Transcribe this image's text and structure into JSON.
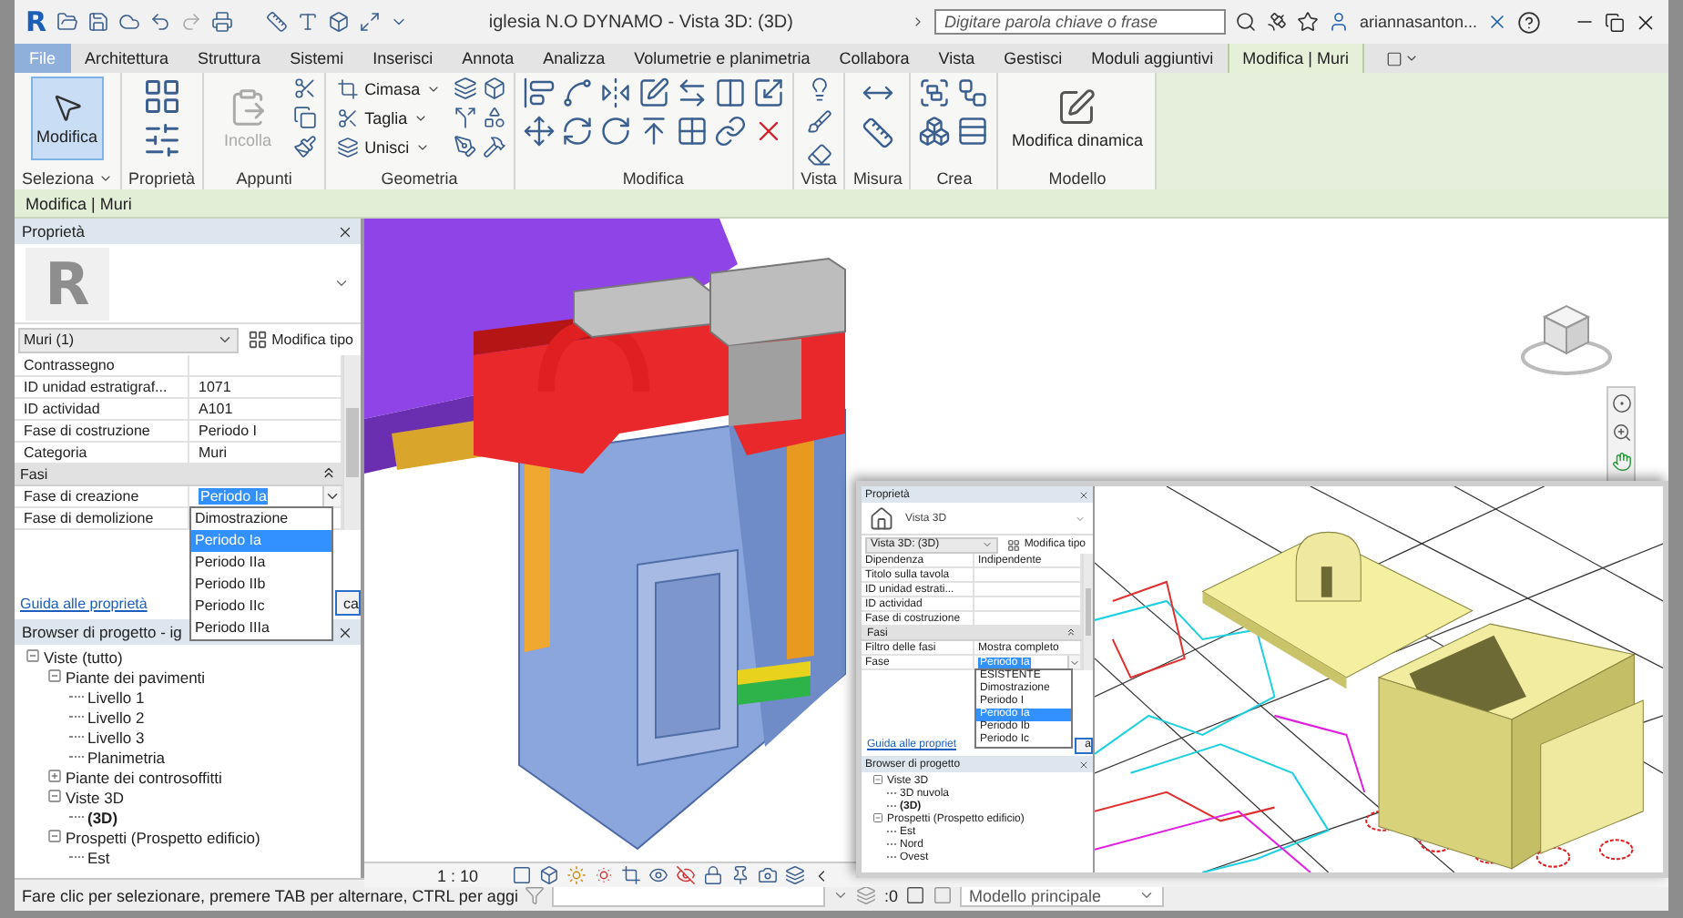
{
  "app_logo": "R",
  "title_bar": {
    "title": "iglesia N.O DYNAMO - Vista 3D: (3D)",
    "search": {
      "placeholder": "Digitare parola chiave o frase"
    },
    "user": "ariannasanton..."
  },
  "ribbon_tabs": [
    {
      "label": "File",
      "selected": false
    },
    {
      "label": "Architettura",
      "selected": false
    },
    {
      "label": "Struttura",
      "selected": false
    },
    {
      "label": "Sistemi",
      "selected": false
    },
    {
      "label": "Inserisci",
      "selected": false
    },
    {
      "label": "Annota",
      "selected": false
    },
    {
      "label": "Analizza",
      "selected": false
    },
    {
      "label": "Volumetrie e planimetria",
      "selected": false
    },
    {
      "label": "Collabora",
      "selected": false
    },
    {
      "label": "Vista",
      "selected": false
    },
    {
      "label": "Gestisci",
      "selected": false
    },
    {
      "label": "Moduli aggiuntivi",
      "selected": false
    },
    {
      "label": "Modifica | Muri",
      "selected": true
    }
  ],
  "ribbon_panels": [
    {
      "label": "Seleziona",
      "menu": true,
      "tools": [
        {
          "kind": "large",
          "label": "Modifica",
          "selected": true,
          "disabled": false
        }
      ]
    },
    {
      "label": "Proprietà",
      "menu": false,
      "tools": [
        {
          "kind": "icons"
        }
      ]
    },
    {
      "label": "Appunti",
      "menu": false,
      "tools": [
        {
          "kind": "large",
          "label": "Incolla",
          "selected": false,
          "disabled": true
        },
        {
          "kind": "icons"
        }
      ]
    },
    {
      "label": "Geometria",
      "menu": false,
      "tools": [
        {
          "kind": "small",
          "label": "Cimasa"
        },
        {
          "kind": "small",
          "label": "Taglia"
        },
        {
          "kind": "small",
          "label": "Unisci"
        },
        {
          "kind": "icons"
        }
      ]
    },
    {
      "label": "Modifica",
      "menu": false,
      "tools": [
        {
          "kind": "icons"
        }
      ]
    },
    {
      "label": "Vista",
      "menu": false,
      "tools": [
        {
          "kind": "icons"
        }
      ]
    },
    {
      "label": "Misura",
      "menu": false,
      "tools": [
        {
          "kind": "icons"
        }
      ]
    },
    {
      "label": "Crea",
      "menu": false,
      "tools": [
        {
          "kind": "icons"
        }
      ]
    },
    {
      "label": "Modello",
      "menu": false,
      "tools": [
        {
          "kind": "large",
          "label": "Modifica dinamica",
          "selected": false,
          "disabled": false
        }
      ]
    }
  ],
  "context_bar": {
    "label": "Modifica | Muri"
  },
  "properties": {
    "title": "Proprietà",
    "type_logo": "R",
    "type_selector": "Muri (1)",
    "edit_type_button": "Modifica tipo",
    "rows": [
      {
        "kind": "param",
        "label": "Contrassegno",
        "editing": false
      },
      {
        "kind": "param",
        "label": "ID unidad estratigraf...",
        "value": "1071",
        "editing": false
      },
      {
        "kind": "param",
        "label": "ID actividad",
        "value": "A101",
        "editing": false
      },
      {
        "kind": "param",
        "label": "Fase di costruzione",
        "value": "Periodo I",
        "editing": false
      },
      {
        "kind": "param",
        "label": "Categoria",
        "value": "Muri",
        "editing": false
      },
      {
        "kind": "group",
        "label": "Fasi",
        "expanded": true
      },
      {
        "kind": "param",
        "label": "Fase di creazione",
        "value": "Periodo Ia",
        "editing": true
      },
      {
        "kind": "param",
        "label": "Fase di demolizione",
        "editing": false
      }
    ],
    "dropdown": {
      "options": [
        {
          "label": "Dimostrazione",
          "selected": false
        },
        {
          "label": "Periodo Ia",
          "selected": true
        },
        {
          "label": "Periodo IIa",
          "selected": false
        },
        {
          "label": "Periodo IIb",
          "selected": false
        },
        {
          "label": "Periodo IIc",
          "selected": false
        },
        {
          "label": "Periodo IIIa",
          "selected": false
        }
      ]
    },
    "help_link": "Guida alle proprietà",
    "apply_button": "ca"
  },
  "project_browser": {
    "title": "Browser di progetto - ig",
    "tree": [
      {
        "label": "Viste (tutto)",
        "expanded": true,
        "active": false,
        "children": [
          {
            "label": "Piante dei pavimenti",
            "expanded": true,
            "active": false,
            "children": [
              {
                "label": "Livello 1",
                "active": false
              },
              {
                "label": "Livello 2",
                "active": false
              },
              {
                "label": "Livello 3",
                "active": false
              },
              {
                "label": "Planimetria",
                "active": false
              }
            ]
          },
          {
            "label": "Piante dei controsoffitti",
            "expanded": false,
            "active": false
          },
          {
            "label": "Viste 3D",
            "expanded": true,
            "active": false,
            "children": [
              {
                "label": "(3D)",
                "active": true
              }
            ]
          },
          {
            "label": "Prospetti (Prospetto edificio)",
            "expanded": true,
            "active": false,
            "children": [
              {
                "label": "Est",
                "active": false
              }
            ]
          }
        ]
      }
    ]
  },
  "viewport": {
    "scale": "1 : 10"
  },
  "inset": {
    "properties": {
      "title": "Proprietà",
      "type_name": "Vista 3D",
      "type_selector": "Vista 3D: (3D)",
      "edit_type_button": "Modifica tipo",
      "rows": [
        {
          "kind": "param",
          "label": "Dipendenza",
          "value": "Indipendente",
          "editing": false
        },
        {
          "kind": "param",
          "label": "Titolo sulla tavola",
          "editing": false
        },
        {
          "kind": "param",
          "label": "ID unidad estrati...",
          "editing": false
        },
        {
          "kind": "param",
          "label": "ID actividad",
          "editing": false
        },
        {
          "kind": "param",
          "label": "Fase di costruzione",
          "editing": false
        },
        {
          "kind": "group",
          "label": "Fasi",
          "expanded": true
        },
        {
          "kind": "param",
          "label": "Filtro delle fasi",
          "value": "Mostra completo",
          "editing": false
        },
        {
          "kind": "param",
          "label": "Fase",
          "value": "Periodo Ia",
          "editing": true
        }
      ],
      "dropdown": {
        "options": [
          {
            "label": "ESISTENTE",
            "selected": false
          },
          {
            "label": "Dimostrazione",
            "selected": false
          },
          {
            "label": "Periodo I",
            "selected": false
          },
          {
            "label": "Periodo Ia",
            "selected": true
          },
          {
            "label": "Periodo Ib",
            "selected": false
          },
          {
            "label": "Periodo Ic",
            "selected": false
          }
        ]
      },
      "help_link": "Guida alle propriet",
      "apply_button": "a"
    },
    "browser": {
      "title": "Browser di progetto",
      "tree": [
        {
          "label": "Viste 3D",
          "expanded": true,
          "active": false,
          "children": [
            {
              "label": "3D nuvola",
              "active": false
            },
            {
              "label": "(3D)",
              "active": true
            }
          ]
        },
        {
          "label": "Prospetti (Prospetto edificio)",
          "expanded": true,
          "active": false,
          "children": [
            {
              "label": "Est",
              "active": false
            },
            {
              "label": "Nord",
              "active": false
            },
            {
              "label": "Ovest",
              "active": false
            }
          ]
        }
      ]
    }
  },
  "status_bar": {
    "message": "Fare clic per selezionare, premere TAB per alternare, CTRL per aggi",
    "design_options": ":0",
    "workset": "Modello principale"
  }
}
